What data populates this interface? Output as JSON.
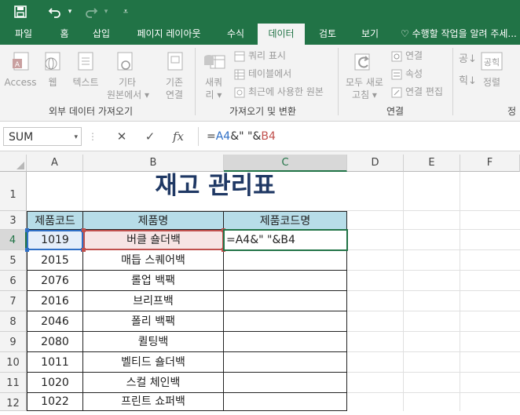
{
  "quick_access": {
    "save_icon": "save-icon",
    "undo_icon": "undo-icon",
    "redo_icon": "redo-icon",
    "customize_icon": "customize-icon"
  },
  "tabs": [
    "파일",
    "홈",
    "삽입",
    "페이지 레이아웃",
    "수식",
    "데이터",
    "검토",
    "보기"
  ],
  "active_tab": "데이터",
  "tell_me": "수행할 작업을 알려 주세...",
  "ribbon": {
    "access": "Access",
    "web": "웹",
    "text": "텍스트",
    "other_1": "기타",
    "other_2": "원본에서 ▾",
    "existing_1": "기존",
    "existing_2": "연결",
    "new_query_1": "새쿼",
    "new_query_2": "리 ▾",
    "show_queries": "쿼리 표시",
    "from_table": "테이블에서",
    "recent_sources": "최근에 사용한 원본",
    "refresh_all_1": "모두 새로",
    "refresh_all_2": "고침 ▾",
    "connections": "연결",
    "properties": "속성",
    "edit_links": "연결 편집",
    "sort": "정렬",
    "group_external": "외부 데이터 가져오기",
    "group_get_transform": "가져오기 및 변환",
    "group_connections": "연결",
    "group_sort": "정"
  },
  "formula_bar": {
    "name_box": "SUM",
    "cancel": "✕",
    "enter": "✓",
    "fx": "fx",
    "formula_part1": "=",
    "formula_ref1": "A4",
    "formula_mid": "&\" \"&",
    "formula_ref2": "B4"
  },
  "columns": [
    "A",
    "B",
    "C",
    "D",
    "E",
    "F"
  ],
  "rows": [
    "1",
    "3",
    "4",
    "5",
    "6",
    "7",
    "8",
    "9",
    "10",
    "11",
    "12"
  ],
  "sheet": {
    "title": "재고 관리표",
    "headers": [
      "제품코드",
      "제품명",
      "제품코드명"
    ],
    "editing_cell": "=A4&\" \"&B4",
    "data": [
      {
        "code": "1019",
        "name": "버클 숄더백"
      },
      {
        "code": "2015",
        "name": "매듭 스퀘어백"
      },
      {
        "code": "2076",
        "name": "롤업 백팩"
      },
      {
        "code": "2016",
        "name": "브리프백"
      },
      {
        "code": "2046",
        "name": "폴리 백팩"
      },
      {
        "code": "2080",
        "name": "퀼팅백"
      },
      {
        "code": "1011",
        "name": "벨티드 숄더백"
      },
      {
        "code": "1020",
        "name": "스컬 체인백"
      },
      {
        "code": "1022",
        "name": "프린트 쇼퍼백"
      }
    ]
  },
  "colors": {
    "excel_green": "#217346",
    "header_fill": "#b7dde8",
    "title_color": "#1f3864",
    "ref_a4": "#2f6fc6",
    "ref_b4": "#c0504d"
  }
}
